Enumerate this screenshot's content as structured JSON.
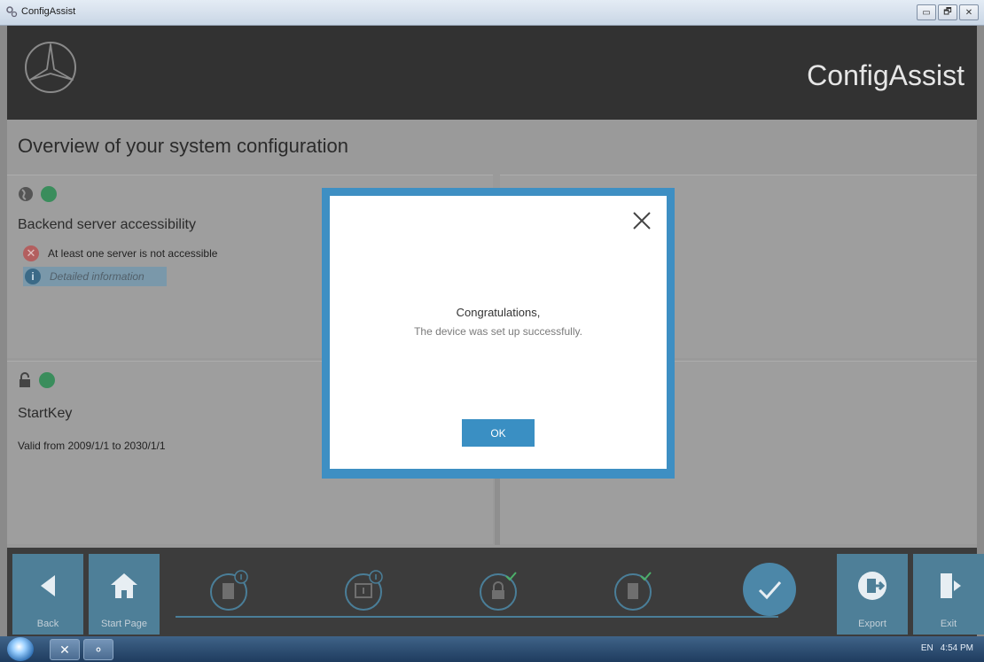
{
  "window": {
    "title": "ConfigAssist",
    "controls": [
      "▭",
      "🗗",
      "✕"
    ]
  },
  "header": {
    "brand": "ConfigAssist",
    "logo_icon": "mercedes-star-icon"
  },
  "main": {
    "page_title": "Overview of your system configuration",
    "backend": {
      "title": "Backend server accessibility",
      "error_text": "At least one server is not accessible",
      "details_label": "Detailed information"
    },
    "startkey": {
      "title": "StartKey",
      "validity": "Valid from 2009/1/1 to 2030/1/1"
    }
  },
  "footer": {
    "back_label": "Back",
    "start_label": "Start Page",
    "export_label": "Export",
    "exit_label": "Exit"
  },
  "dialog": {
    "title_line": "Congratulations,",
    "message": "The device was set up successfully.",
    "ok_label": "OK"
  },
  "taskbar": {
    "tray_text": [
      "EN",
      "4:54 PM"
    ]
  },
  "colors": {
    "accent": "#3e8fc3",
    "header_bg": "#323232",
    "success": "#3a8d5c",
    "error": "#b35f5f"
  }
}
